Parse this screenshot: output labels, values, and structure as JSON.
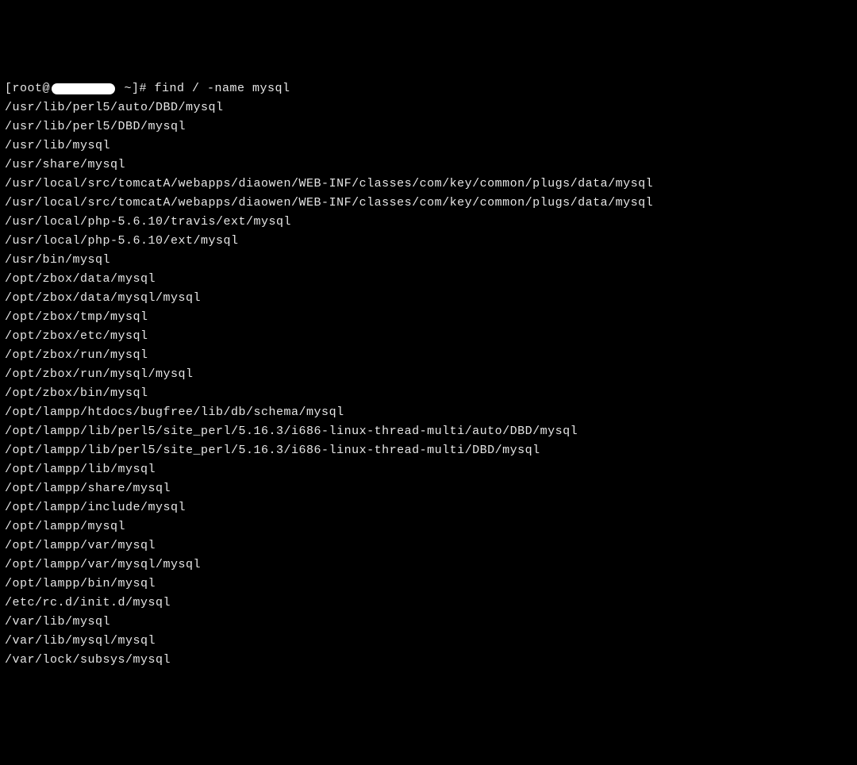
{
  "prompt": {
    "prefix": "[root@",
    "suffix": " ~]# ",
    "command": "find / -name mysql"
  },
  "output": [
    "/usr/lib/perl5/auto/DBD/mysql",
    "/usr/lib/perl5/DBD/mysql",
    "/usr/lib/mysql",
    "/usr/share/mysql",
    "/usr/local/src/tomcatA/webapps/diaowen/WEB-INF/classes/com/key/common/plugs/data/mysql",
    "/usr/local/src/tomcatA/webapps/diaowen/WEB-INF/classes/com/key/common/plugs/data/mysql",
    "/usr/local/php-5.6.10/travis/ext/mysql",
    "/usr/local/php-5.6.10/ext/mysql",
    "/usr/bin/mysql",
    "/opt/zbox/data/mysql",
    "/opt/zbox/data/mysql/mysql",
    "/opt/zbox/tmp/mysql",
    "/opt/zbox/etc/mysql",
    "/opt/zbox/run/mysql",
    "/opt/zbox/run/mysql/mysql",
    "/opt/zbox/bin/mysql",
    "/opt/lampp/htdocs/bugfree/lib/db/schema/mysql",
    "/opt/lampp/lib/perl5/site_perl/5.16.3/i686-linux-thread-multi/auto/DBD/mysql",
    "/opt/lampp/lib/perl5/site_perl/5.16.3/i686-linux-thread-multi/DBD/mysql",
    "/opt/lampp/lib/mysql",
    "/opt/lampp/share/mysql",
    "/opt/lampp/include/mysql",
    "/opt/lampp/mysql",
    "/opt/lampp/var/mysql",
    "/opt/lampp/var/mysql/mysql",
    "/opt/lampp/bin/mysql",
    "/etc/rc.d/init.d/mysql",
    "/var/lib/mysql",
    "/var/lib/mysql/mysql",
    "/var/lock/subsys/mysql"
  ]
}
